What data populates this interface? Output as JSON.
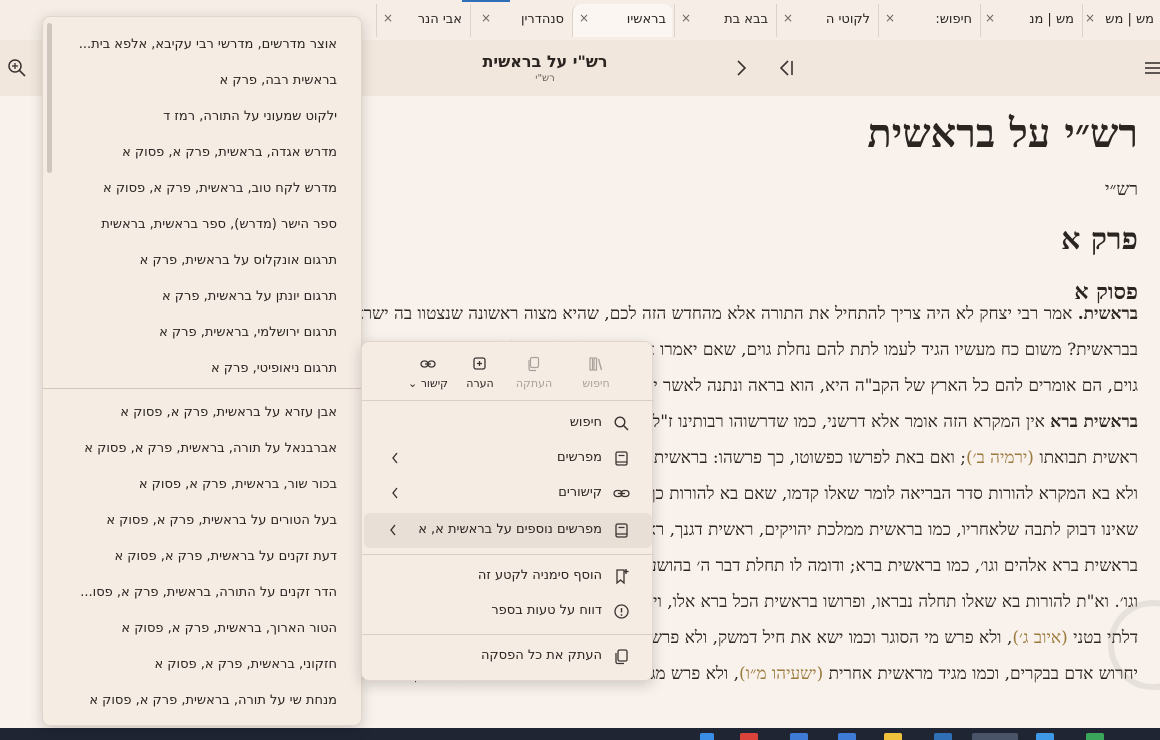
{
  "tabs": [
    {
      "label": "מש | מש",
      "active": false
    },
    {
      "label": "מש | מנ",
      "active": false
    },
    {
      "label": "חיפוש:",
      "active": false
    },
    {
      "label": "לקוטי ה",
      "active": false
    },
    {
      "label": "בבא בת",
      "active": false
    },
    {
      "label": "בראשיו",
      "active": false
    },
    {
      "label": "סנהדרין",
      "active": false
    },
    {
      "label": "אבי הנר",
      "active": false
    }
  ],
  "tab_close_glyph": "×",
  "header": {
    "title": "רש\"י על בראשית",
    "subtitle": "רש\"י"
  },
  "content": {
    "book_title": "רש״י על בראשית",
    "author": "רש״י",
    "chapter": "פרק א",
    "verse": "פסוק א",
    "lines": [
      {
        "parts": [
          {
            "t": "בראשית.",
            "s": "lead"
          },
          {
            "t": " אמר רבי יצחק לא היה צריך להתחיל את התורה אלא מהחדש הזה לכם, שהיא מצוה ראשונה שנצטוו בה ישראל, ומה טעם פתח"
          }
        ]
      },
      {
        "parts": [
          {
            "t": "בבראשית? משום כח מעשיו הגיד לעמו לתת להם נחלת גוים, שאם יאמרו אומות העולם לישראל ליסטים אתם, שכבשתם ארצות שבעה"
          }
        ]
      },
      {
        "parts": [
          {
            "t": "גוים, הם אומרים להם כל הארץ של הקב\"ה היא, הוא בראה ונתנה לאשר ישר בעיניו, ברצונו נתנה להם וברצונו נטלה מהם ונתנה לנו:"
          }
        ]
      },
      {
        "parts": [
          {
            "t": "בראשית ברא",
            "s": "lead"
          },
          {
            "t": " אין המקרא הזה אומר אלא דרשני, כמו שדרשוהו רבותינו ז\"ל בשביל התורה שנקראת ראשית דרכו, ובשביל ישראל שנקראו"
          }
        ]
      },
      {
        "parts": [
          {
            "t": "ראשית תבואתו "
          },
          {
            "t": "(ירמיה ב׳)",
            "s": "ref"
          },
          {
            "t": "; ואם באת לפרשו כפשוטו, כך פרשהו: בראשית בריאת שמים וארץ והארץ היתה תהו ובהו וחשך ויאמר אלהים יהי אור"
          }
        ]
      },
      {
        "parts": [
          {
            "t": "ולא בא המקרא להורות סדר הבריאה לומר שאלו קדמו, שאם בא להורות כך היה לו לכתוב בראשונה ברא את השמים וגו׳, שאין לך ראשית"
          }
        ]
      },
      {
        "parts": [
          {
            "t": "שאינו דבוק לתבה שלאחריו, כמו בראשית ממלכת יהויקים, ראשית דגנך, ראשית ממלכתו; אף כאן אתה אומר בראשית ברא אלהים וגו׳ כמו"
          }
        ]
      },
      {
        "parts": [
          {
            "t": "בראשית ברא אלהים וגו׳, כמו בראשית ברא; ודומה לו תחלת דבר ה׳ בהושע, כלומר תחלת דבורו של הקב\"ה בהושע ויאמר ה׳"
          }
        ]
      },
      {
        "parts": [
          {
            "t": "וגו׳. וא\"ת להורות בא שאלו תחלה נבראו, ופרושו בראשית הכל ברא אלו, ויש לך מקראות שמקצרים לשונם וממעטים תבה אחת, כמו כי לא סגר"
          }
        ]
      },
      {
        "parts": [
          {
            "t": "דלתי בטני "
          },
          {
            "t": "(איוב ג׳)",
            "s": "ref"
          },
          {
            "t": ", ולא פרש מי הסוגר וכמו ישא את חיל דמשק, ולא פרש מי ישאנו, וכמו אם יחרוש בבקרים, ולא"
          }
        ]
      },
      {
        "parts": [
          {
            "t": "יחרוש אדם בבקרים, וכמו מגיד מראשית אחרית "
          },
          {
            "t": "(ישעיהו מ״ו)",
            "s": "ref"
          },
          {
            "t": ", ולא פרש מגיד מראשית דבר אחרית דבר, ואם כן תמה על עצמך, כי המים קדמו"
          }
        ]
      }
    ]
  },
  "links_panel": {
    "items": [
      "אוצר מדרשים, מדרשי רבי עקיבא, אלפא בית...",
      "בראשית רבה, פרק א",
      "ילקוט שמעוני על התורה, רמז ד",
      "מדרש אגדה, בראשית, פרק א, פסוק א",
      "מדרש לקח טוב, בראשית, פרק א, פסוק א",
      "ספר הישר (מדרש), ספר בראשית, בראשית",
      "תרגום אונקלוס על בראשית, פרק א",
      "תרגום יונתן על בראשית, פרק א",
      "תרגום ירושלמי, בראשית, פרק א",
      "תרגום ניאופיטי, פרק א",
      "אבן עזרא על בראשית, פרק א, פסוק א",
      "אברבנאל על תורה, בראשית, פרק א, פסוק א",
      "בכור שור, בראשית, פרק א, פסוק א",
      "בעל הטורים על בראשית, פרק א, פסוק א",
      "דעת זקנים על בראשית, פרק א, פסוק א",
      "הדר זקנים על התורה, בראשית, פרק א, פסו...",
      "הטור הארוך, בראשית, פרק א, פסוק א",
      "חזקוני, בראשית, פרק א, פסוק א",
      "מנחת שי על תורה, בראשית, פרק א, פסוק א"
    ]
  },
  "context_menu": {
    "toolbar": [
      {
        "name": "search",
        "label": "חיפוש",
        "enabled": false
      },
      {
        "name": "copy",
        "label": "העתקה",
        "enabled": false
      },
      {
        "name": "note",
        "label": "הערה",
        "enabled": true
      },
      {
        "name": "link",
        "label": "קישור",
        "enabled": true
      }
    ],
    "items": [
      {
        "label": "חיפוש",
        "icon": "search-icon",
        "submenu": false,
        "highlighted": false
      },
      {
        "label": "מפרשים",
        "icon": "book-icon",
        "submenu": true,
        "highlighted": false
      },
      {
        "label": "קישורים",
        "icon": "link-icon",
        "submenu": true,
        "highlighted": false
      },
      {
        "label": "מפרשים נוספים על בראשית א, א",
        "icon": "book-icon",
        "submenu": true,
        "highlighted": true
      },
      {
        "label": "הוסף סימניה לקטע זה",
        "icon": "bookmark-add-icon",
        "submenu": false,
        "highlighted": false
      },
      {
        "label": "דווח על טעות בספר",
        "icon": "alert-icon",
        "submenu": false,
        "highlighted": false
      },
      {
        "label": "העתק את כל הפסקה",
        "icon": "copy-icon",
        "submenu": false,
        "highlighted": false
      }
    ]
  },
  "colors": {
    "background": "#f9f2ec",
    "header": "#f2e7dc",
    "accent": "#2f6fb6",
    "reference": "#9b7a3c",
    "menu_hover": "#e8dfd7"
  }
}
